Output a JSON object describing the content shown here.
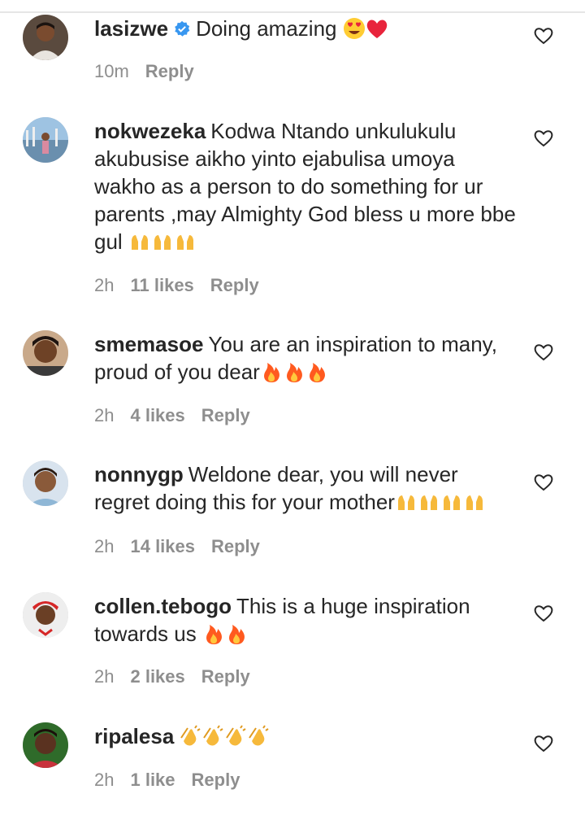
{
  "comments": [
    {
      "user": "lasizwe",
      "verified": true,
      "text": "Doing amazing",
      "emoji": [
        "heart-eyes",
        "red-heart"
      ],
      "time": "10m",
      "likes": "",
      "reply": "Reply"
    },
    {
      "user": "nokwezeka",
      "verified": false,
      "text": "Kodwa Ntando unkulukulu akubusise aikho yinto ejabulisa umoya wakho as a person to do something for ur parents ,may Almighty God bless u more bbe gul",
      "emoji": [
        "raising-hands",
        "raising-hands",
        "raising-hands"
      ],
      "time": "2h",
      "likes": "11 likes",
      "reply": "Reply"
    },
    {
      "user": "smemasoe",
      "verified": false,
      "text": "You are an inspiration to many, proud of you dear",
      "emoji": [
        "fire",
        "fire",
        "fire"
      ],
      "time": "2h",
      "likes": "4 likes",
      "reply": "Reply"
    },
    {
      "user": "nonnygp",
      "verified": false,
      "text": "Weldone dear, you will never regret doing this for your mother",
      "emoji": [
        "raising-hands",
        "raising-hands",
        "raising-hands",
        "raising-hands"
      ],
      "time": "2h",
      "likes": "14 likes",
      "reply": "Reply"
    },
    {
      "user": "collen.tebogo",
      "verified": false,
      "text": "This is a huge inspiration towards us",
      "emoji": [
        "fire",
        "fire"
      ],
      "time": "2h",
      "likes": "2 likes",
      "reply": "Reply"
    },
    {
      "user": "ripalesa",
      "verified": false,
      "text": "",
      "emoji": [
        "clapping-hands",
        "clapping-hands",
        "clapping-hands",
        "clapping-hands"
      ],
      "time": "2h",
      "likes": "1 like",
      "reply": "Reply"
    }
  ],
  "colors": {
    "text": "#262626",
    "meta": "#8e8e8e",
    "verified": "#3897f0"
  }
}
